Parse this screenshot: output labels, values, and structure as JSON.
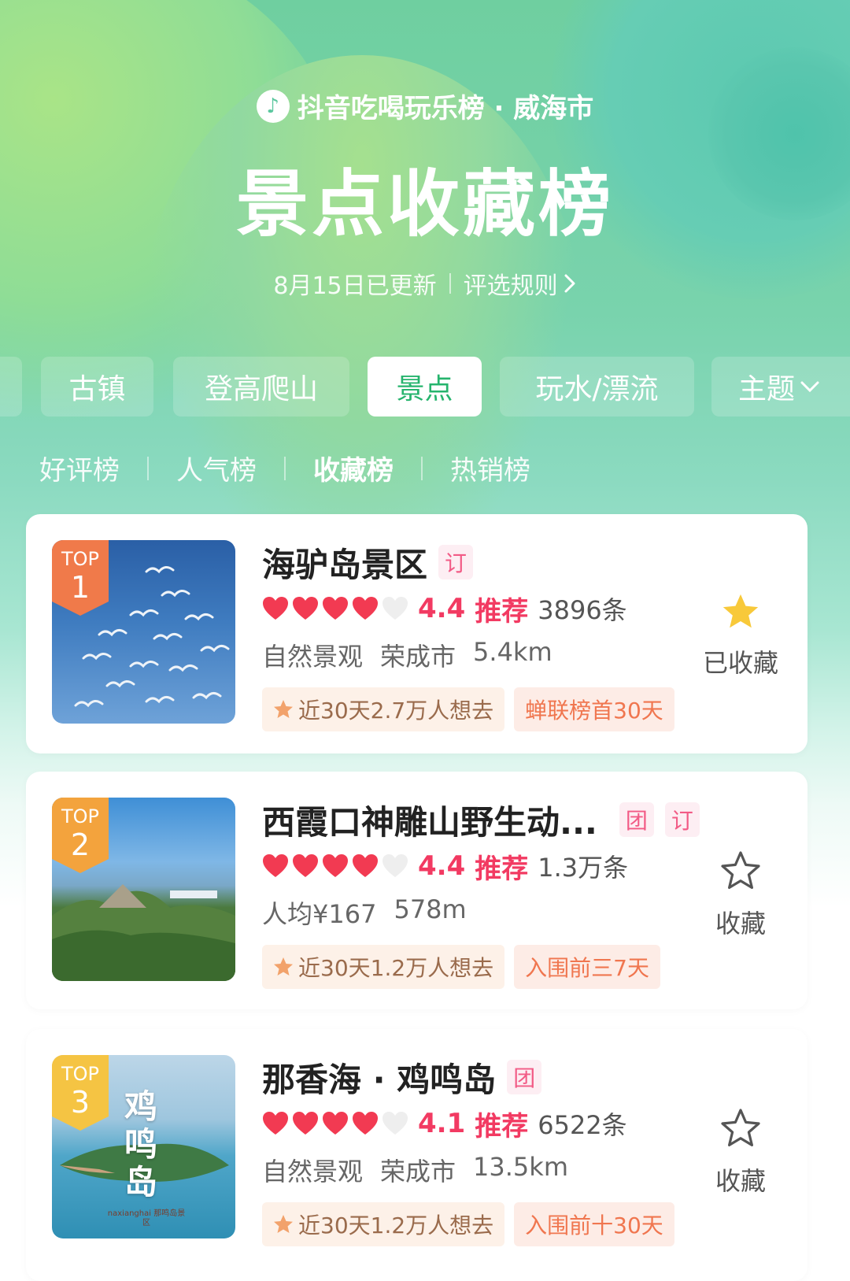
{
  "header": {
    "brand": "抖音吃喝玩乐榜 · 威海市",
    "title": "景点收藏榜",
    "updated": "8月15日已更新",
    "rules": "评选规则"
  },
  "category_tabs": [
    "古镇",
    "登高爬山",
    "景点",
    "玩水/漂流",
    "主题"
  ],
  "sub_tabs": [
    "好评榜",
    "人气榜",
    "收藏榜",
    "热销榜"
  ],
  "items": [
    {
      "rank_top": "TOP",
      "rank": "1",
      "name": "海驴岛景区",
      "tags": [
        "订"
      ],
      "score": "4.4",
      "rec": "推荐",
      "reviews": "3896条",
      "meta": [
        "自然景观",
        "荣成市",
        "5.4km"
      ],
      "want": "近30天2.7万人想去",
      "rank_badge": "蝉联榜首30天",
      "fav_label": "已收藏",
      "fav_state": "on"
    },
    {
      "rank_top": "TOP",
      "rank": "2",
      "name": "西霞口神雕山野生动...",
      "tags": [
        "团",
        "订"
      ],
      "score": "4.4",
      "rec": "推荐",
      "reviews": "1.3万条",
      "meta": [
        "人均¥167",
        "578m"
      ],
      "want": "近30天1.2万人想去",
      "rank_badge": "入围前三7天",
      "fav_label": "收藏",
      "fav_state": "off"
    },
    {
      "rank_top": "TOP",
      "rank": "3",
      "name": "那香海 · 鸡鸣岛",
      "tags": [
        "团"
      ],
      "score": "4.1",
      "rec": "推荐",
      "reviews": "6522条",
      "meta": [
        "自然景观",
        "荣成市",
        "13.5km"
      ],
      "want": "近30天1.2万人想去",
      "rank_badge": "入围前十30天",
      "fav_label": "收藏",
      "fav_state": "off",
      "thumb_text": "鸡鸣岛",
      "thumb_caption": "naxianghai 那鸣岛景区"
    }
  ],
  "colors": {
    "accent_red": "#f23a62",
    "tab_active_green": "#26b46d",
    "star_gold": "#f8c93a",
    "rank1": "#f07a4a",
    "rank2": "#f3a33d",
    "rank3": "#f5c443"
  }
}
